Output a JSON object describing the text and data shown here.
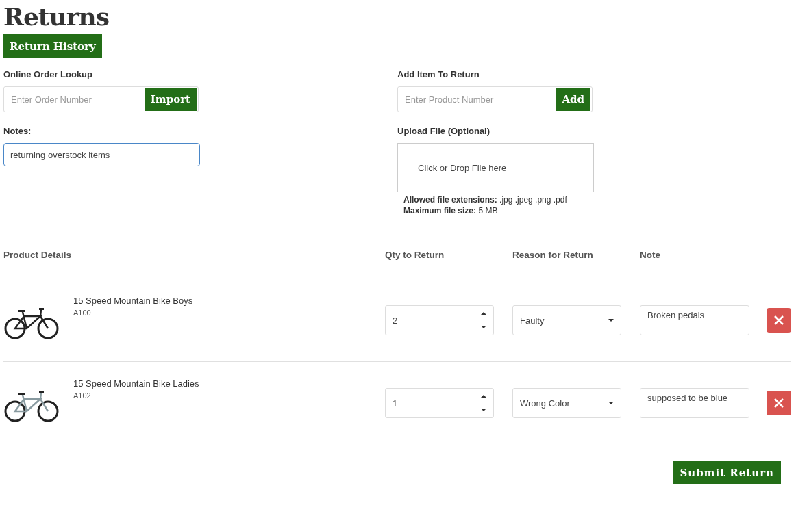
{
  "title": "Returns",
  "history_button": "Return History",
  "order_lookup": {
    "label": "Online Order Lookup",
    "placeholder": "Enter Order Number",
    "button": "Import"
  },
  "add_item": {
    "label": "Add Item To Return",
    "placeholder": "Enter Product Number",
    "button": "Add"
  },
  "notes": {
    "label": "Notes:",
    "value": "returning overstock items"
  },
  "upload": {
    "label": "Upload File (Optional)",
    "drop_text": "Click or Drop File here",
    "extensions_label": "Allowed file extensions:",
    "extensions": ".jpg .jpeg .png .pdf",
    "size_label": "Maximum file size:",
    "size": "5 MB"
  },
  "table": {
    "columns": [
      "Product Details",
      "Qty to Return",
      "Reason for Return",
      "Note"
    ],
    "rows": [
      {
        "name": "15 Speed Mountain Bike Boys",
        "sku": "A100",
        "qty": "2",
        "reason": "Faulty",
        "note": "Broken pedals",
        "kind": "bmx"
      },
      {
        "name": "15 Speed Mountain Bike Ladies",
        "sku": "A102",
        "qty": "1",
        "reason": "Wrong Color",
        "note": "supposed to be blue",
        "kind": "mountain"
      }
    ]
  },
  "submit_button": "Submit Return"
}
